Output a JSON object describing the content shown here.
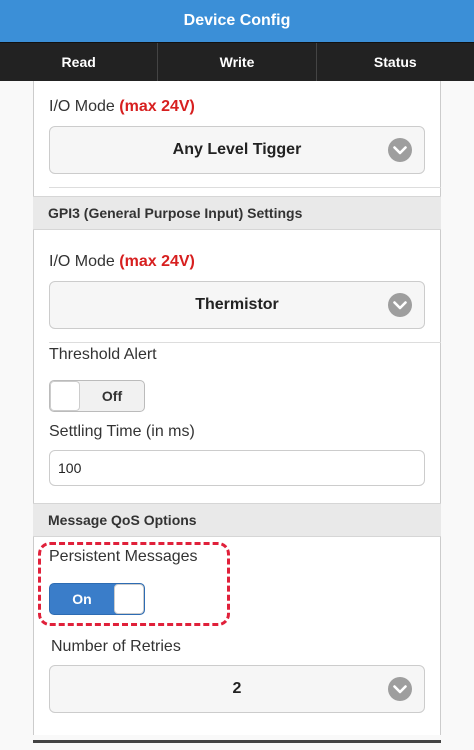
{
  "header": {
    "title": "Device Config"
  },
  "tabs": [
    {
      "label": "Read"
    },
    {
      "label": "Write"
    },
    {
      "label": "Status"
    }
  ],
  "gpi2": {
    "io_mode_label": "I/O Mode",
    "io_mode_note": "(max 24V)",
    "io_mode_value": "Any Level Tigger"
  },
  "gpi3": {
    "section_title": "GPI3 (General Purpose Input) Settings",
    "io_mode_label": "I/O Mode",
    "io_mode_note": "(max 24V)",
    "io_mode_value": "Thermistor",
    "threshold_label": "Threshold Alert",
    "threshold_state": "Off",
    "settling_label": "Settling Time (in ms)",
    "settling_value": "100"
  },
  "qos": {
    "section_title": "Message QoS Options",
    "persistent_label": "Persistent Messages",
    "persistent_state": "On",
    "retries_label": "Number of Retries",
    "retries_value": "2"
  },
  "colors": {
    "accent": "#3b8fd7",
    "highlight": "#e0203a",
    "note": "#d71f1f"
  },
  "icons": {
    "select_arrow": "chevron-down-icon"
  }
}
